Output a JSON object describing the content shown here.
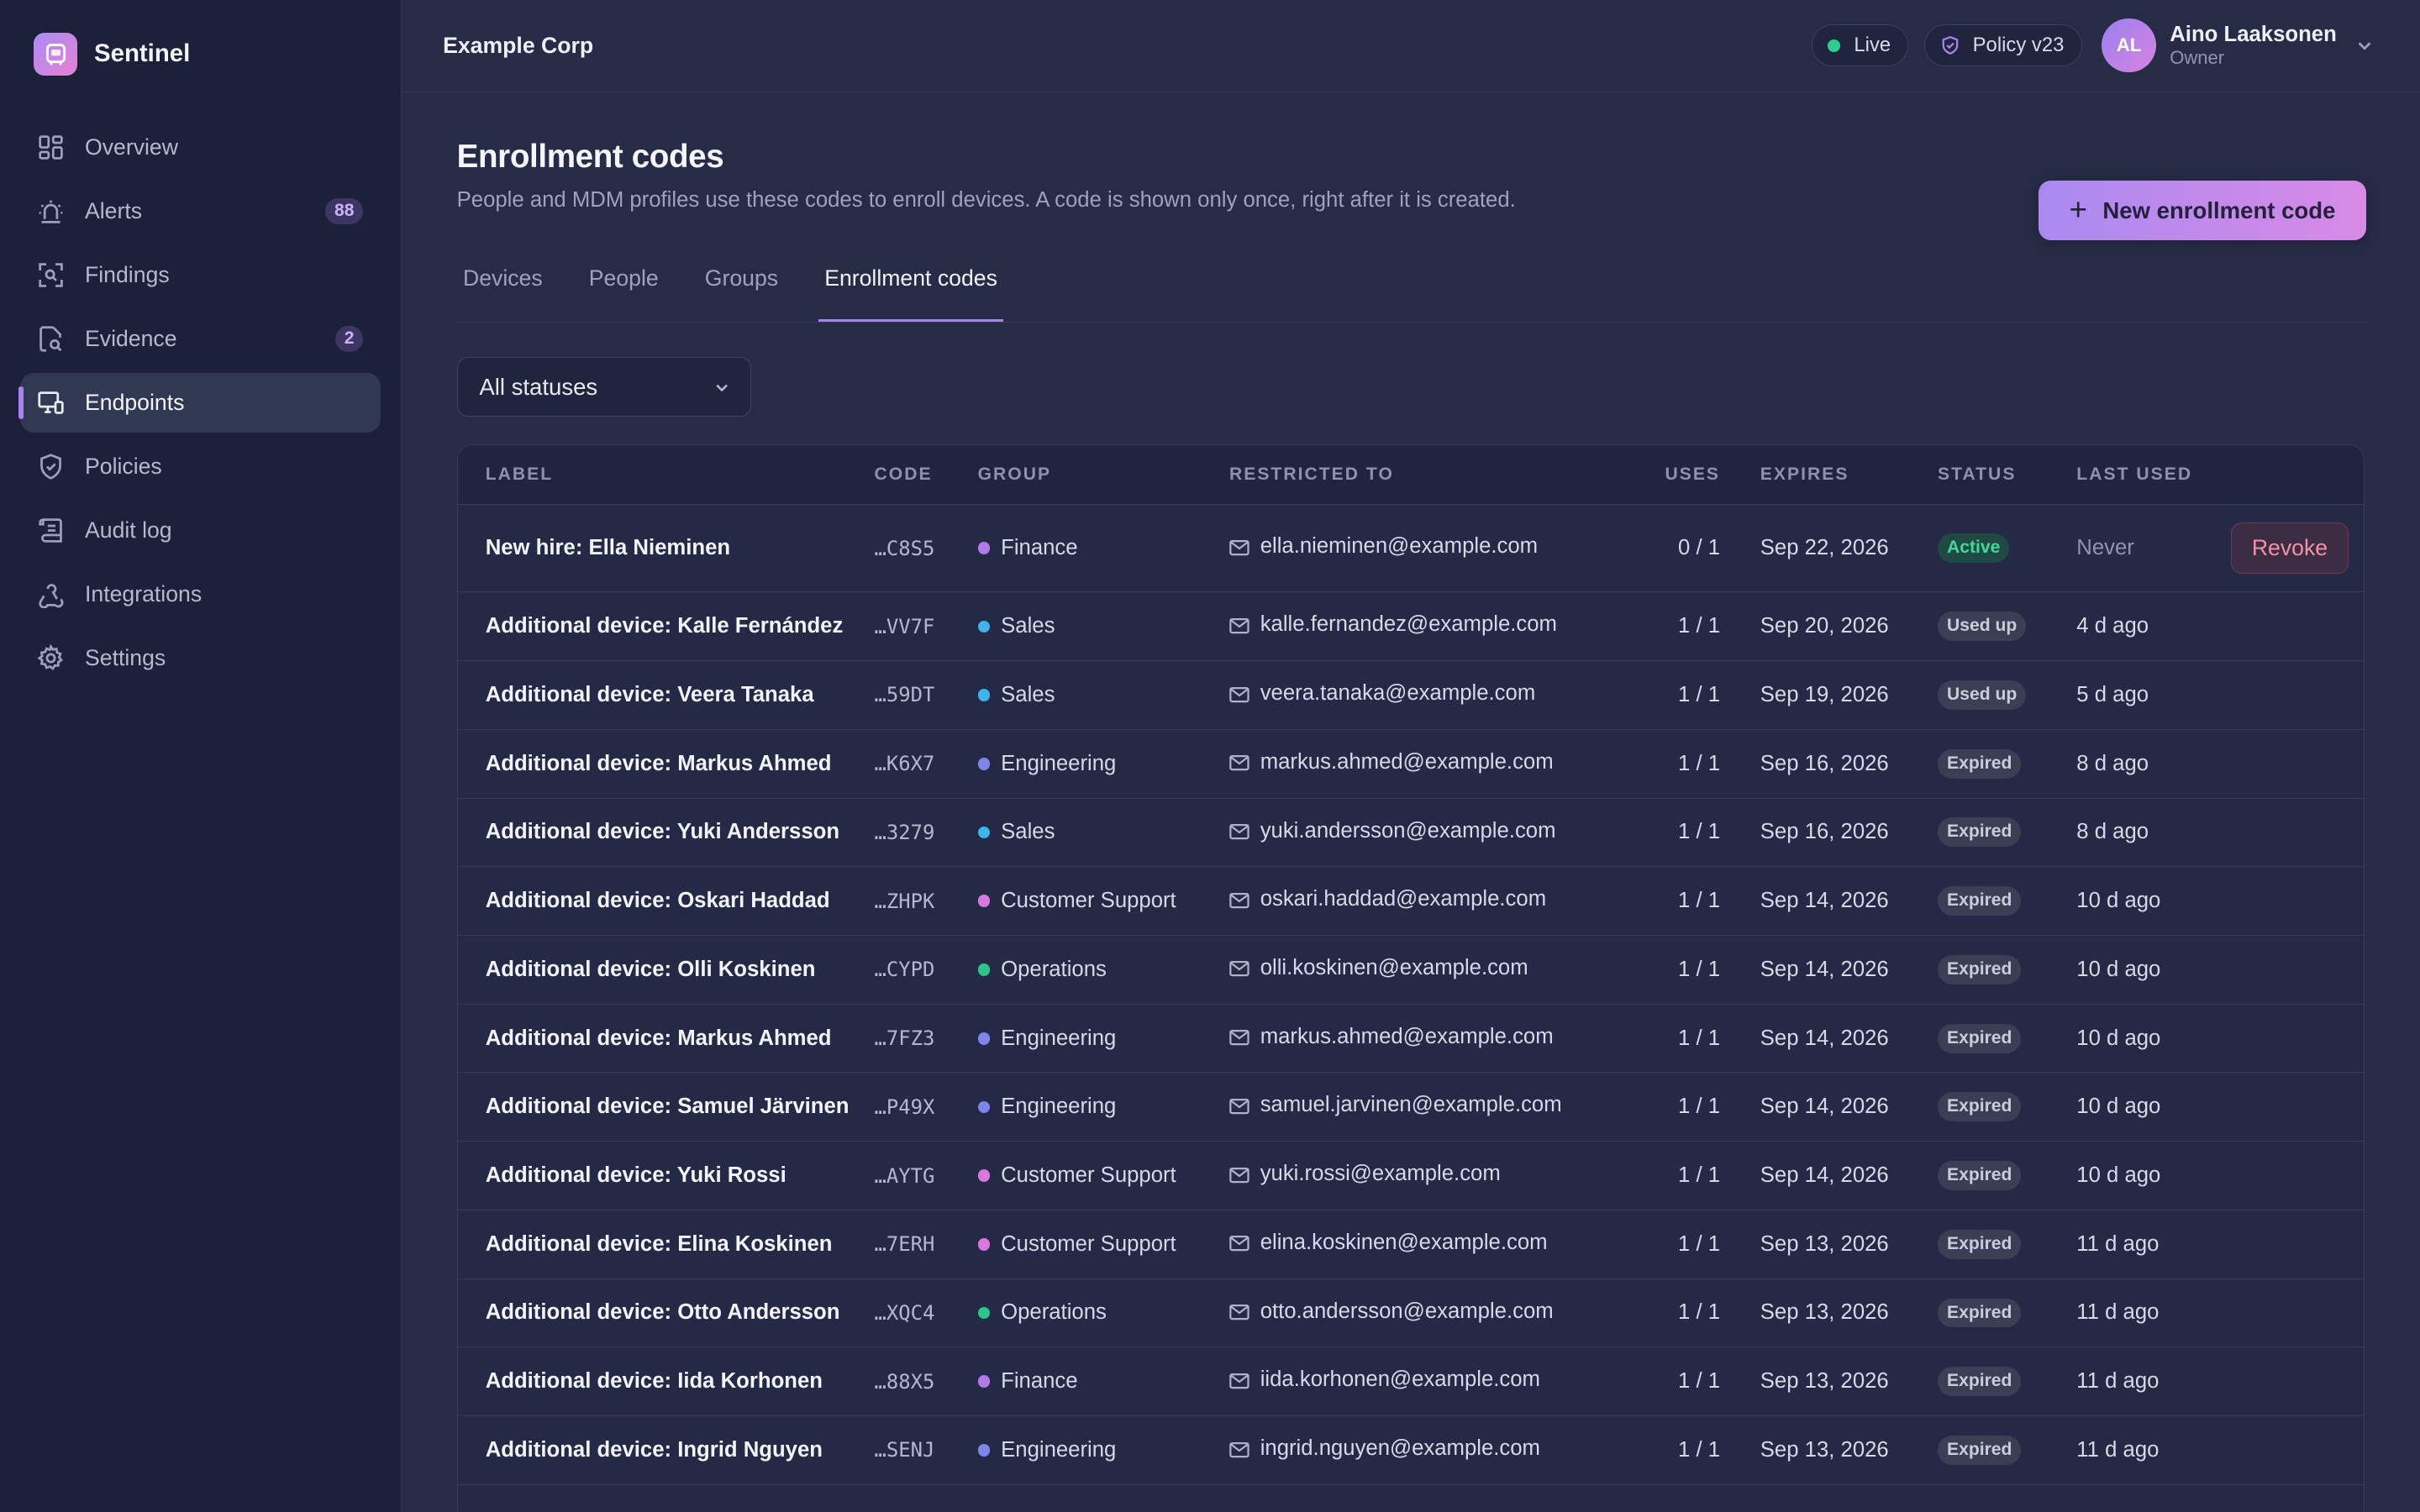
{
  "brand": {
    "name": "Sentinel",
    "accent": "#a883f0"
  },
  "sidebar": {
    "items": [
      {
        "id": "overview",
        "label": "Overview",
        "icon": "grid-icon",
        "badge": ""
      },
      {
        "id": "alerts",
        "label": "Alerts",
        "icon": "siren-icon",
        "badge": "88"
      },
      {
        "id": "findings",
        "label": "Findings",
        "icon": "scan-icon",
        "badge": ""
      },
      {
        "id": "evidence",
        "label": "Evidence",
        "icon": "file-search-icon",
        "badge": "2"
      },
      {
        "id": "endpoints",
        "label": "Endpoints",
        "icon": "monitor-icon",
        "badge": "",
        "active": true
      },
      {
        "id": "policies",
        "label": "Policies",
        "icon": "shield-icon",
        "badge": ""
      },
      {
        "id": "audit-log",
        "label": "Audit log",
        "icon": "scroll-icon",
        "badge": ""
      },
      {
        "id": "integrations",
        "label": "Integrations",
        "icon": "webhook-icon",
        "badge": ""
      },
      {
        "id": "settings",
        "label": "Settings",
        "icon": "gear-icon",
        "badge": ""
      }
    ]
  },
  "topbar": {
    "org": "Example Corp",
    "live": "Live",
    "policy": "Policy v23",
    "user": {
      "initials": "AL",
      "name": "Aino Laaksonen",
      "role": "Owner"
    }
  },
  "page": {
    "title": "Enrollment codes",
    "subtitle": "People and MDM profiles use these codes to enroll devices. A code is shown only once, right after it is created.",
    "new_button": "New enrollment code"
  },
  "tabs": [
    {
      "label": "Devices",
      "active": false
    },
    {
      "label": "People",
      "active": false
    },
    {
      "label": "Groups",
      "active": false
    },
    {
      "label": "Enrollment codes",
      "active": true
    }
  ],
  "filter": {
    "value": "All statuses"
  },
  "table": {
    "columns": [
      "LABEL",
      "CODE",
      "GROUP",
      "RESTRICTED TO",
      "USES",
      "EXPIRES",
      "STATUS",
      "LAST USED"
    ],
    "group_colors": {
      "Finance": "#b07ae8",
      "Sales": "#3fb4ea",
      "Engineering": "#7f86ea",
      "Customer Support": "#d978df",
      "Operations": "#2fc48a"
    },
    "rows": [
      {
        "label": "New hire: Ella Nieminen",
        "code": "…C8S5",
        "group": "Finance",
        "email": "ella.nieminen@example.com",
        "uses": "0 / 1",
        "expires": "Sep 22, 2026",
        "status": "Active",
        "last_used": "Never",
        "action": "Revoke"
      },
      {
        "label": "Additional device: Kalle Fernández",
        "code": "…VV7F",
        "group": "Sales",
        "email": "kalle.fernandez@example.com",
        "uses": "1 / 1",
        "expires": "Sep 20, 2026",
        "status": "Used up",
        "last_used": "4 d ago"
      },
      {
        "label": "Additional device: Veera Tanaka",
        "code": "…59DT",
        "group": "Sales",
        "email": "veera.tanaka@example.com",
        "uses": "1 / 1",
        "expires": "Sep 19, 2026",
        "status": "Used up",
        "last_used": "5 d ago"
      },
      {
        "label": "Additional device: Markus Ahmed",
        "code": "…K6X7",
        "group": "Engineering",
        "email": "markus.ahmed@example.com",
        "uses": "1 / 1",
        "expires": "Sep 16, 2026",
        "status": "Expired",
        "last_used": "8 d ago"
      },
      {
        "label": "Additional device: Yuki Andersson",
        "code": "…3279",
        "group": "Sales",
        "email": "yuki.andersson@example.com",
        "uses": "1 / 1",
        "expires": "Sep 16, 2026",
        "status": "Expired",
        "last_used": "8 d ago"
      },
      {
        "label": "Additional device: Oskari Haddad",
        "code": "…ZHPK",
        "group": "Customer Support",
        "email": "oskari.haddad@example.com",
        "uses": "1 / 1",
        "expires": "Sep 14, 2026",
        "status": "Expired",
        "last_used": "10 d ago"
      },
      {
        "label": "Additional device: Olli Koskinen",
        "code": "…CYPD",
        "group": "Operations",
        "email": "olli.koskinen@example.com",
        "uses": "1 / 1",
        "expires": "Sep 14, 2026",
        "status": "Expired",
        "last_used": "10 d ago"
      },
      {
        "label": "Additional device: Markus Ahmed",
        "code": "…7FZ3",
        "group": "Engineering",
        "email": "markus.ahmed@example.com",
        "uses": "1 / 1",
        "expires": "Sep 14, 2026",
        "status": "Expired",
        "last_used": "10 d ago"
      },
      {
        "label": "Additional device: Samuel Järvinen",
        "code": "…P49X",
        "group": "Engineering",
        "email": "samuel.jarvinen@example.com",
        "uses": "1 / 1",
        "expires": "Sep 14, 2026",
        "status": "Expired",
        "last_used": "10 d ago"
      },
      {
        "label": "Additional device: Yuki Rossi",
        "code": "…AYTG",
        "group": "Customer Support",
        "email": "yuki.rossi@example.com",
        "uses": "1 / 1",
        "expires": "Sep 14, 2026",
        "status": "Expired",
        "last_used": "10 d ago"
      },
      {
        "label": "Additional device: Elina Koskinen",
        "code": "…7ERH",
        "group": "Customer Support",
        "email": "elina.koskinen@example.com",
        "uses": "1 / 1",
        "expires": "Sep 13, 2026",
        "status": "Expired",
        "last_used": "11 d ago"
      },
      {
        "label": "Additional device: Otto Andersson",
        "code": "…XQC4",
        "group": "Operations",
        "email": "otto.andersson@example.com",
        "uses": "1 / 1",
        "expires": "Sep 13, 2026",
        "status": "Expired",
        "last_used": "11 d ago"
      },
      {
        "label": "Additional device: Iida Korhonen",
        "code": "…88X5",
        "group": "Finance",
        "email": "iida.korhonen@example.com",
        "uses": "1 / 1",
        "expires": "Sep 13, 2026",
        "status": "Expired",
        "last_used": "11 d ago"
      },
      {
        "label": "Additional device: Ingrid Nguyen",
        "code": "…SENJ",
        "group": "Engineering",
        "email": "ingrid.nguyen@example.com",
        "uses": "1 / 1",
        "expires": "Sep 13, 2026",
        "status": "Expired",
        "last_used": "11 d ago"
      }
    ]
  }
}
